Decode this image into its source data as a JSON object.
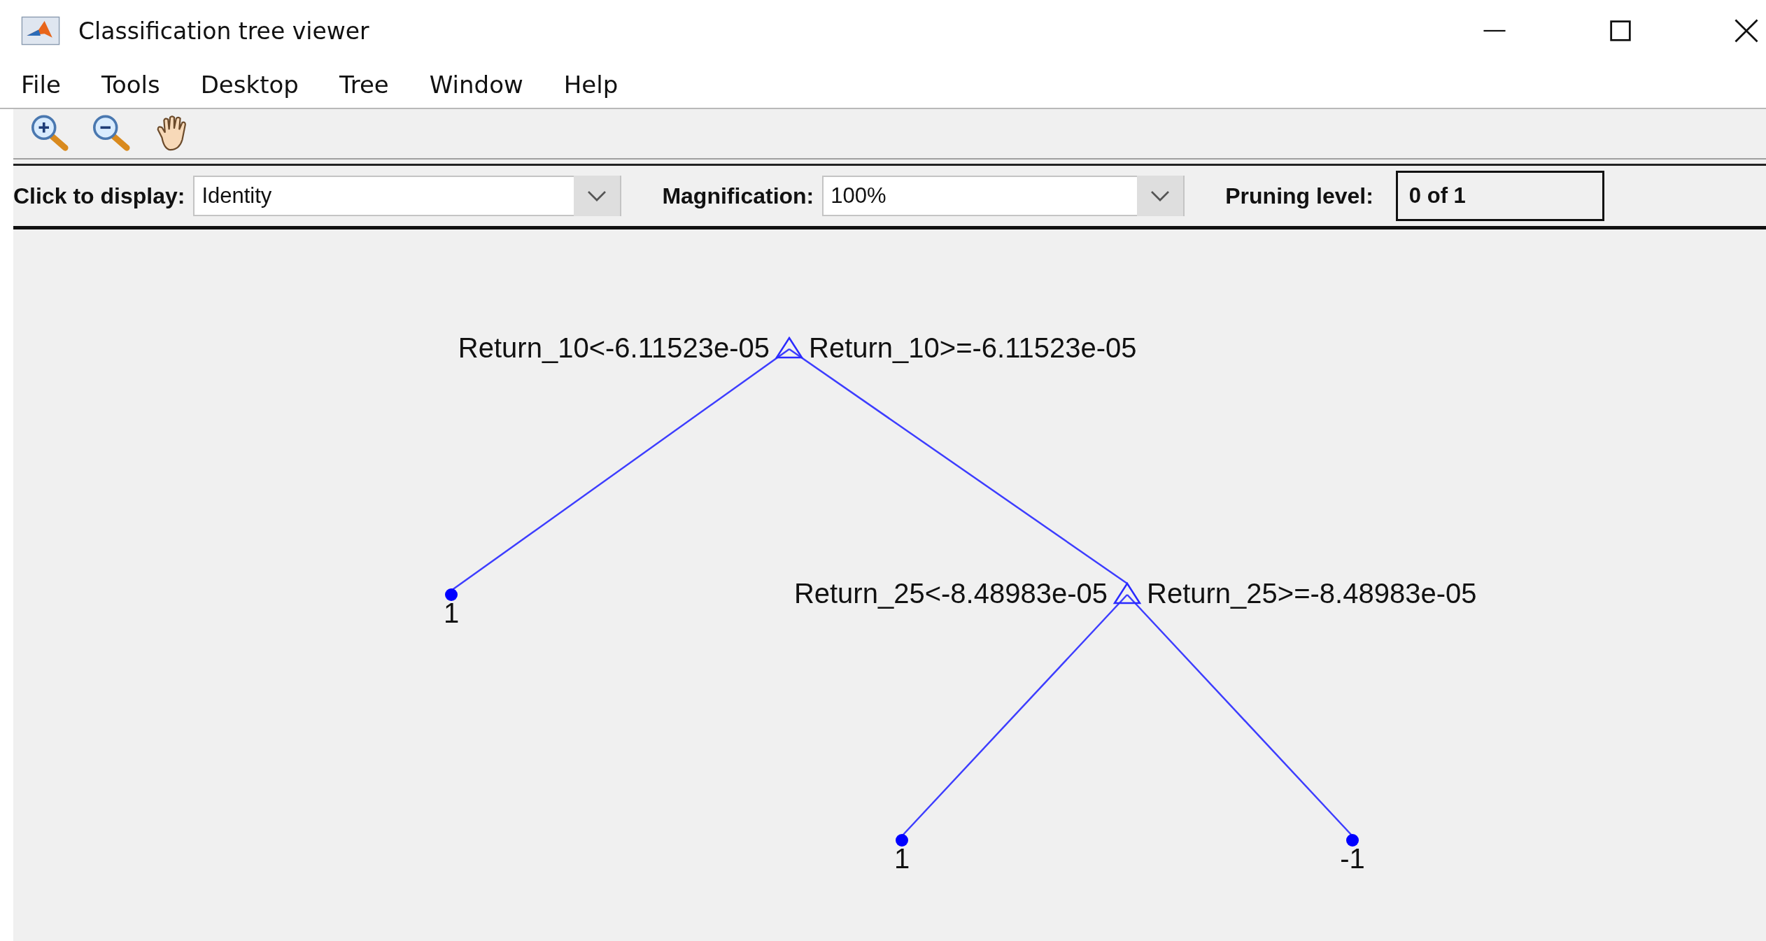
{
  "window": {
    "title": "Classification tree viewer"
  },
  "menu": [
    "File",
    "Tools",
    "Desktop",
    "Tree",
    "Window",
    "Help"
  ],
  "controls": {
    "display": {
      "label": "Click to display:",
      "value": "Identity"
    },
    "magnification": {
      "label": "Magnification:",
      "value": "100%"
    },
    "pruning": {
      "label": "Pruning level:",
      "value": "0 of 1"
    }
  },
  "tree": {
    "kind": "split",
    "left_label": "Return_10<-6.11523e-05",
    "right_label": "Return_10>=-6.11523e-05",
    "children": [
      {
        "kind": "leaf",
        "label": "1"
      },
      {
        "kind": "split",
        "left_label": "Return_25<-8.48983e-05",
        "right_label": "Return_25>=-8.48983e-05",
        "children": [
          {
            "kind": "leaf",
            "label": "1"
          },
          {
            "kind": "leaf",
            "label": "-1"
          }
        ]
      }
    ]
  }
}
